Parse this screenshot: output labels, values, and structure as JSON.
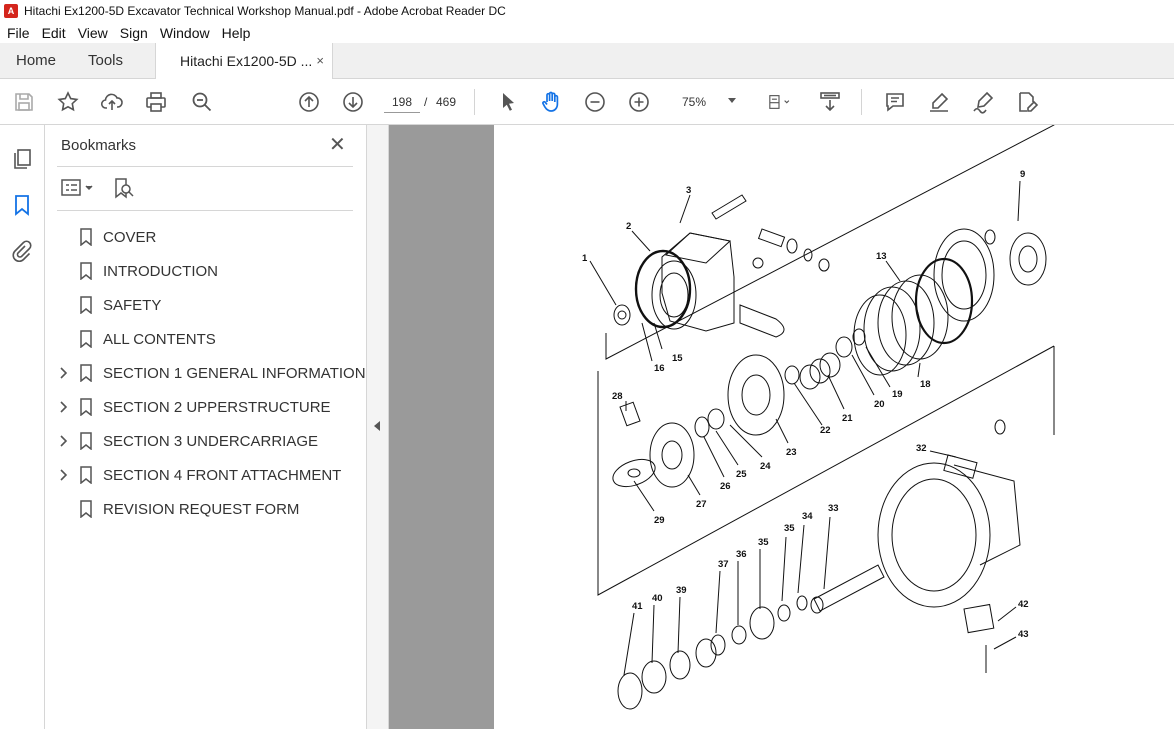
{
  "window": {
    "title": "Hitachi Ex1200-5D Excavator Technical Workshop Manual.pdf - Adobe Acrobat Reader DC",
    "app_icon": "acrobat-icon"
  },
  "menu": [
    "File",
    "Edit",
    "View",
    "Sign",
    "Window",
    "Help"
  ],
  "tabs": {
    "home": "Home",
    "tools": "Tools",
    "document": "Hitachi Ex1200-5D ...",
    "close_glyph": "×"
  },
  "toolbar": {
    "current_page": "198",
    "separator": "/",
    "total_pages": "469",
    "zoom": "75%"
  },
  "bookmarks": {
    "title": "Bookmarks",
    "close_glyph": "✕",
    "items": [
      {
        "label": "COVER",
        "expandable": false
      },
      {
        "label": "INTRODUCTION",
        "expandable": false
      },
      {
        "label": "SAFETY",
        "expandable": false
      },
      {
        "label": "ALL CONTENTS",
        "expandable": false
      },
      {
        "label": "SECTION 1 GENERAL INFORMATION",
        "expandable": true
      },
      {
        "label": "SECTION 2 UPPERSTRUCTURE",
        "expandable": true
      },
      {
        "label": "SECTION 3 UNDERCARRIAGE",
        "expandable": true
      },
      {
        "label": "SECTION 4 FRONT ATTACHMENT",
        "expandable": true
      },
      {
        "label": "REVISION REQUEST FORM",
        "expandable": false
      }
    ]
  },
  "document": {
    "callouts": [
      "1",
      "2",
      "3",
      "9",
      "13",
      "15",
      "16",
      "18",
      "19",
      "20",
      "21",
      "22",
      "23",
      "24",
      "25",
      "26",
      "27",
      "28",
      "29",
      "32",
      "33",
      "34",
      "35",
      "35",
      "36",
      "37",
      "39",
      "40",
      "41",
      "42",
      "43"
    ]
  },
  "colors": {
    "accent": "#1473e6",
    "pdf_red": "#d4251c",
    "viewer_bg": "#9a9a9a"
  }
}
